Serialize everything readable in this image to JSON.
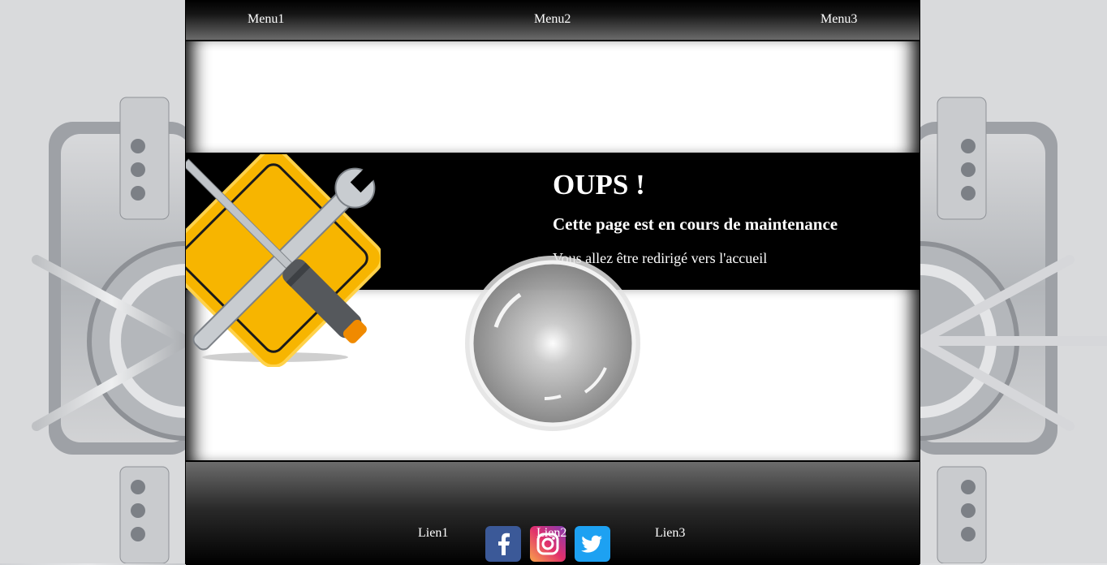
{
  "nav": {
    "menu1": "Menu1",
    "menu2": "Menu2",
    "menu3": "Menu3"
  },
  "main": {
    "title": "OUPS !",
    "subtitle": "Cette page est en cours de maintenance",
    "message": "Vous allez être redirigé vers l'accueil"
  },
  "footer": {
    "social": [
      {
        "name": "facebook-icon",
        "color": "#3b5998"
      },
      {
        "name": "instagram-icon",
        "color": "#e1306c"
      },
      {
        "name": "twitter-icon",
        "color": "#1da1f2"
      }
    ],
    "links": {
      "lien1": "Lien1",
      "lien2": "Lien2",
      "lien3": "Lien3"
    }
  },
  "colors": {
    "page_bg": "#000000",
    "panel_bg": "#ffffff",
    "maintenance_sign": "#f7b500"
  }
}
